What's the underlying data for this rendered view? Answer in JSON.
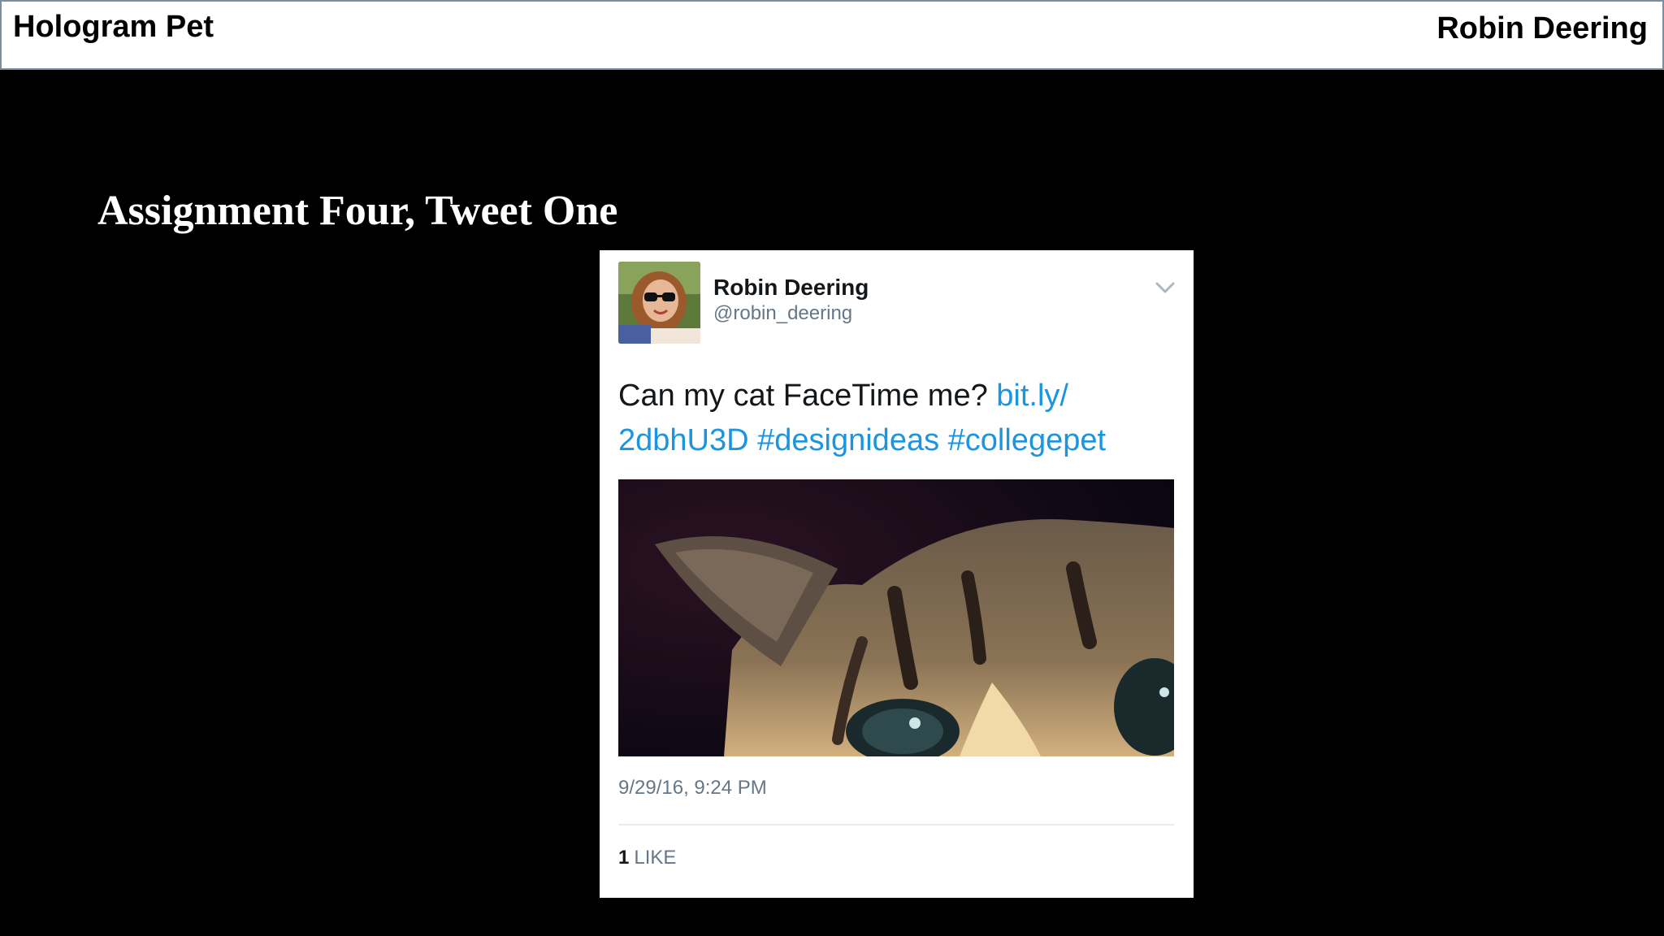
{
  "header": {
    "left_title": "Hologram Pet",
    "right_name": "Robin Deering"
  },
  "slide": {
    "title": "Assignment Four, Tweet One"
  },
  "tweet": {
    "display_name": "Robin Deering",
    "handle": "@robin_deering",
    "text_plain": "Can my cat FaceTime me? ",
    "text_link_1": "bit.ly/",
    "text_link_2": "2dbhU3D",
    "text_hashtag_1": "#designideas",
    "text_hashtag_2": "#collegepet",
    "timestamp": "9/29/16, 9:24 PM",
    "like_count": "1",
    "like_label": "LIKE",
    "menu_icon": "chevron-down-icon",
    "link_color": "#1b95e0"
  }
}
